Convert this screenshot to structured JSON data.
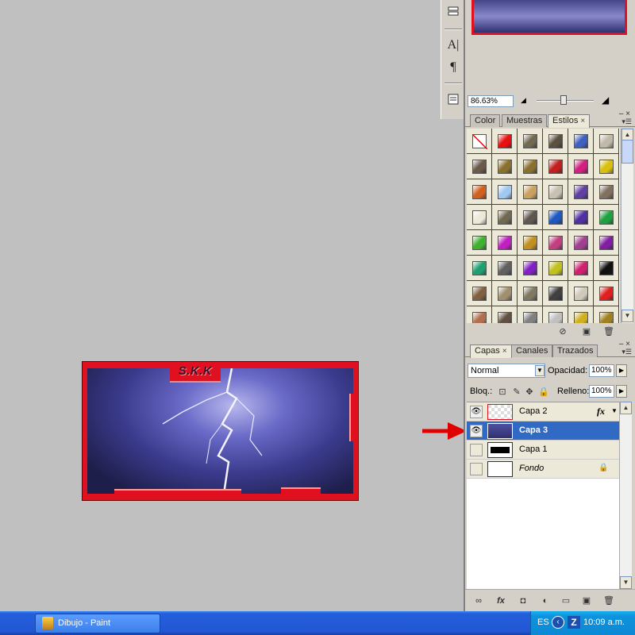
{
  "canvas": {
    "tag_text": "S.K.K"
  },
  "tools": {
    "type_icon": "A|",
    "paragraph_icon": "¶"
  },
  "navigator": {
    "zoom": "86.63%"
  },
  "styles_panel": {
    "tabs": [
      {
        "label": "Color"
      },
      {
        "label": "Muestras"
      },
      {
        "label": "Estilos"
      }
    ],
    "close_glyph": "×",
    "swatches": [
      [
        "#ffffff",
        "#e81010",
        "#706850",
        "#5a5040",
        "#4060c0",
        "#c0b8a8"
      ],
      [
        "#6a5a48",
        "#8a7030",
        "#8a7030",
        "#c02020",
        "#d02080",
        "#d8c010"
      ],
      [
        "#d06020",
        "#a0c8f0",
        "#c8a060",
        "#c8c0b0",
        "#6040a0",
        "#807060"
      ],
      [
        "#ece9d8",
        "#706850",
        "#605850",
        "#2058c0",
        "#5030a0",
        "#20a040"
      ],
      [
        "#40b030",
        "#c020c0",
        "#c09020",
        "#c04080",
        "#a04090",
        "#8020a0"
      ],
      [
        "#20a070",
        "#606060",
        "#8020c0",
        "#c0c020",
        "#d02070",
        "#101010"
      ],
      [
        "#806040",
        "#a09070",
        "#807860",
        "#404040",
        "#d0c8b8",
        "#e02020"
      ],
      [
        "#b07050",
        "#605040",
        "#808080",
        "#c0c0c0",
        "#d0b020",
        "#a08020"
      ]
    ]
  },
  "layers_panel": {
    "tabs": [
      {
        "label": "Capas"
      },
      {
        "label": "Canales"
      },
      {
        "label": "Trazados"
      }
    ],
    "blend_mode": "Normal",
    "opacity_label": "Opacidad:",
    "opacity_value": "100%",
    "lock_label": "Bloq.:",
    "fill_label": "Relleno:",
    "fill_value": "100%",
    "layers": [
      {
        "name": "Capa 2",
        "visible": true,
        "selected": false,
        "fx": "fx"
      },
      {
        "name": "Capa 3",
        "visible": true,
        "selected": true,
        "fx": ""
      },
      {
        "name": "Capa 1",
        "visible": false,
        "selected": false,
        "fx": ""
      },
      {
        "name": "Fondo",
        "visible": false,
        "selected": false,
        "fx": ""
      }
    ]
  },
  "taskbar": {
    "task_label": "Dibujo - Paint",
    "lang": "ES",
    "clock": "10:09 a.m."
  }
}
